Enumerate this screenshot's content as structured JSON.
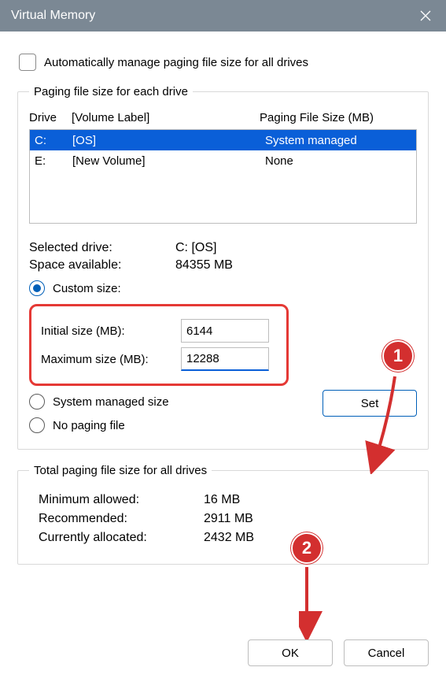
{
  "title": "Virtual Memory",
  "auto_manage_label": "Automatically manage paging file size for all drives",
  "group1_legend": "Paging file size for each drive",
  "drive_header": {
    "c1": "Drive",
    "c2": "[Volume Label]",
    "c3": "Paging File Size (MB)"
  },
  "drives": [
    {
      "letter": "C:",
      "label": "[OS]",
      "size": "System managed",
      "selected": true
    },
    {
      "letter": "E:",
      "label": "[New Volume]",
      "size": "None",
      "selected": false
    }
  ],
  "selected_drive_label": "Selected drive:",
  "selected_drive_value": "C:  [OS]",
  "space_label": "Space available:",
  "space_value": "84355 MB",
  "radio_custom": "Custom size:",
  "initial_label": "Initial size (MB):",
  "initial_value": "6144",
  "max_label": "Maximum size (MB):",
  "max_value": "12288",
  "radio_system": "System managed size",
  "radio_none": "No paging file",
  "set_btn": "Set",
  "totals_legend": "Total paging file size for all drives",
  "min_label": "Minimum allowed:",
  "min_value": "16 MB",
  "rec_label": "Recommended:",
  "rec_value": "2911 MB",
  "cur_label": "Currently allocated:",
  "cur_value": "2432 MB",
  "ok_btn": "OK",
  "cancel_btn": "Cancel",
  "anno": {
    "b1": "1",
    "b2": "2"
  },
  "colors": {
    "accent": "#005fb8",
    "select": "#0a5fd8",
    "red": "#e53935",
    "badge": "#d32f2f",
    "titlebar": "#7b8894"
  }
}
